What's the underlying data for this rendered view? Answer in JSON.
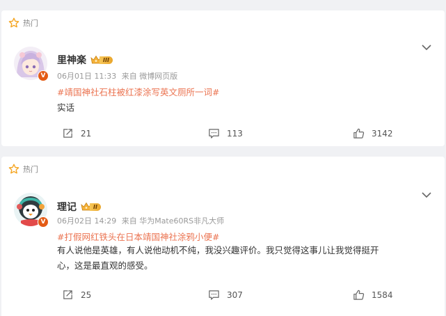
{
  "posts": [
    {
      "hot_label": "热门",
      "user": {
        "name": "里神楽",
        "vip_level": "III",
        "verified_badge": "V"
      },
      "meta": {
        "date": "06月01日 11:33",
        "source": "来自 微博网页版"
      },
      "topic": "#靖国神社石柱被红漆涂写英文厕所一词#",
      "text": "实话",
      "actions": {
        "reposts": "21",
        "comments": "113",
        "likes": "3142"
      }
    },
    {
      "hot_label": "热门",
      "user": {
        "name": "理记",
        "vip_level": "II",
        "verified_badge": "V"
      },
      "meta": {
        "date": "06月02日 14:29",
        "source": "来自 华为Mate60RS非凡大师"
      },
      "topic": "#打假网红铁头在日本靖国神社涂鸦小便#",
      "text_lines": [
        "有人说他是英雄，有人说他动机不纯，我没兴趣评价。我只觉得这事儿让我觉得挺开",
        "心，这是最直观的感受。"
      ],
      "actions": {
        "reposts": "25",
        "comments": "307",
        "likes": "1584"
      }
    }
  ],
  "colors": {
    "accent": "#eb7350",
    "star": "#f5a623",
    "badge": "#e45b15",
    "background": "#f0f1f4"
  }
}
